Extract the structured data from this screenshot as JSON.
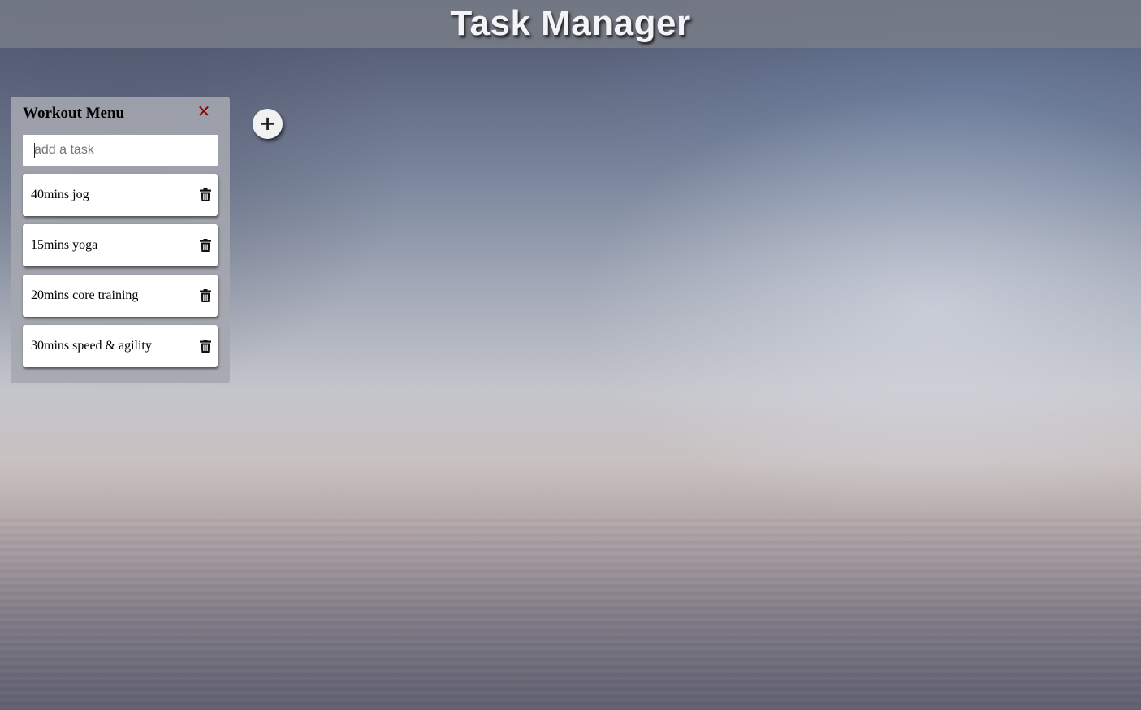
{
  "header": {
    "title": "Task Manager"
  },
  "list": {
    "title": "Workout Menu",
    "close_icon": "close-icon",
    "input_placeholder": "add a task",
    "input_value": "",
    "tasks": [
      {
        "label": "40mins jog",
        "icon": "trash-icon"
      },
      {
        "label": "15mins yoga",
        "icon": "trash-icon"
      },
      {
        "label": "20mins core training",
        "icon": "trash-icon"
      },
      {
        "label": "30mins speed & agility",
        "icon": "trash-icon"
      }
    ]
  },
  "add_list_button": {
    "icon": "plus-icon",
    "label": "+"
  },
  "colors": {
    "header_bg": "#787c87",
    "title_text": "#f3f4f8",
    "panel_bg": "#a5a7af",
    "close_icon": "#8b0000",
    "card_bg": "#ffffff"
  }
}
